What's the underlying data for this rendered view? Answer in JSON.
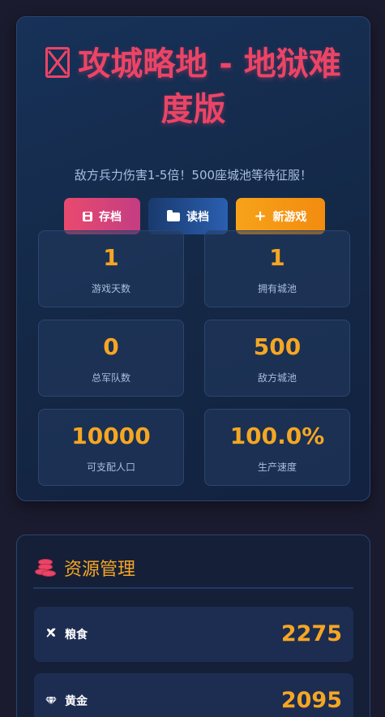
{
  "header": {
    "title": "攻城略地 - 地狱难度版",
    "subtitle": "敌方兵力伤害1-5倍！500座城池等待征服！",
    "buttons": {
      "save": "存档",
      "load": "读档",
      "new_game": "新游戏"
    }
  },
  "stats": [
    {
      "value": "1",
      "label": "游戏天数"
    },
    {
      "value": "1",
      "label": "拥有城池"
    },
    {
      "value": "0",
      "label": "总军队数"
    },
    {
      "value": "500",
      "label": "敌方城池"
    },
    {
      "value": "10000",
      "label": "可支配人口"
    },
    {
      "value": "100.0%",
      "label": "生产速度"
    }
  ],
  "resources": {
    "title": "资源管理",
    "items": [
      {
        "name": "粮食",
        "value": "2275",
        "icon": "wheat-icon"
      },
      {
        "name": "黄金",
        "value": "2095",
        "icon": "gem-icon"
      }
    ]
  },
  "colors": {
    "accent": "#ec4466",
    "gold": "#f5a623",
    "background": "#1b1b2f"
  }
}
